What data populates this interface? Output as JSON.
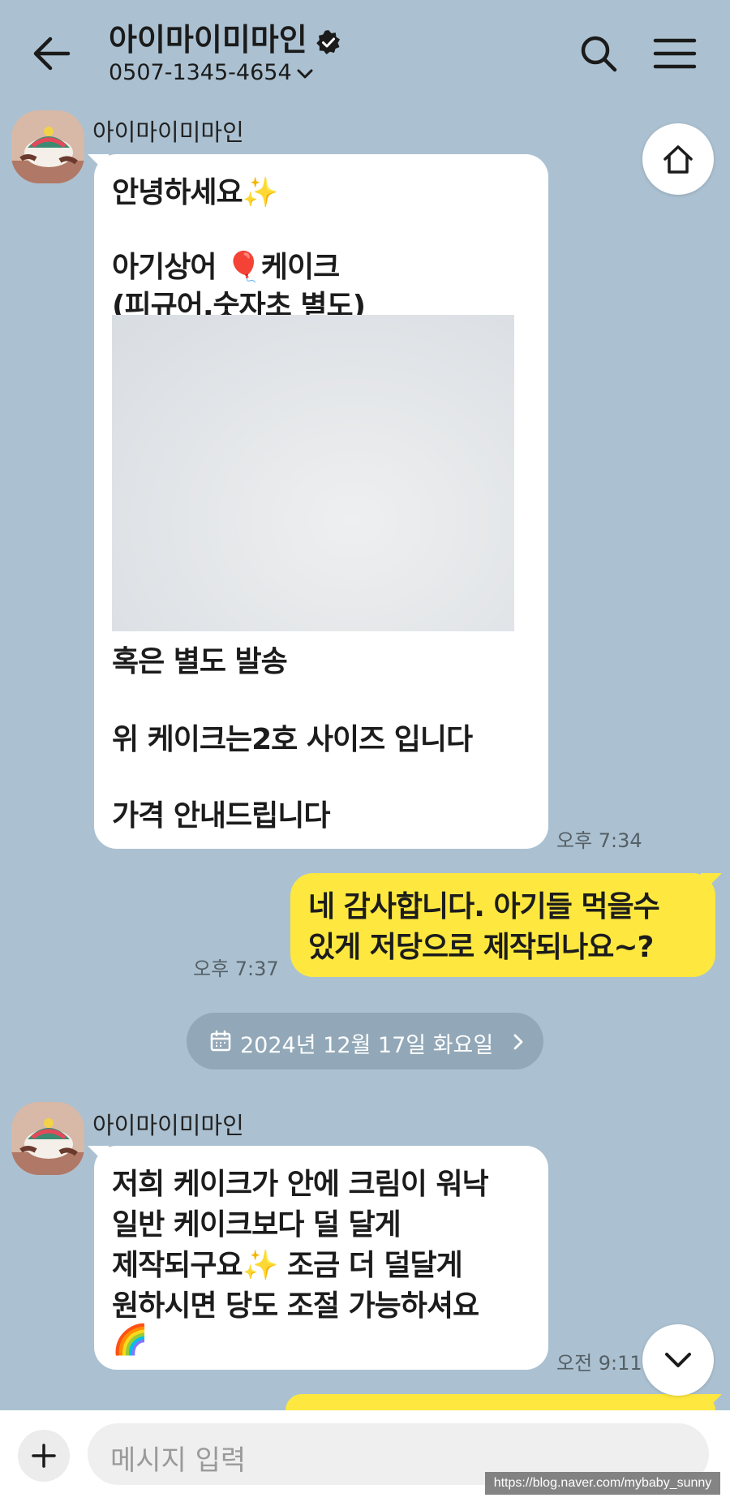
{
  "header": {
    "title": "아이마이미마인",
    "phone": "0507-1345-4654"
  },
  "messages": [
    {
      "sender": "아이마이미마인",
      "lines": [
        "안녕하세요✨",
        "",
        "아기상어 🎈케이크",
        "(피규어,숫자초 별도)"
      ],
      "lines_after_image": [
        "혹은 별도 발송",
        "",
        "위 케이크는2호 사이즈 입니다",
        "",
        "가격 안내드립니다"
      ],
      "time": "오후 7:34"
    },
    {
      "lines": [
        "네 감사합니다. 아기들 먹을수",
        "있게 저당으로 제작되나요~?"
      ],
      "time": "오후 7:37"
    },
    {
      "sender": "아이마이미마인",
      "lines": [
        "저희 케이크가 안에 크림이 워낙",
        "일반 케이크보다 덜 달게",
        "제작되구요✨ 조금 더 덜달게",
        "원하시면 당도 조절 가능하셔요",
        "🌈"
      ],
      "time": "오전 9:11"
    }
  ],
  "date_divider": "2024년 12월 17일 화요일",
  "input": {
    "placeholder": "메시지 입력"
  },
  "watermark": "https://blog.naver.com/mybaby_sunny",
  "colors": {
    "background": "#abc1d1",
    "incoming_bubble": "#ffffff",
    "outgoing_bubble": "#fee83f",
    "date_chip": "#92a8b8"
  },
  "icons": [
    "back-arrow-icon",
    "verified-badge-icon",
    "chevron-down-icon",
    "search-icon",
    "menu-icon",
    "home-icon",
    "calendar-icon",
    "chevron-right-icon",
    "scroll-down-icon",
    "plus-icon"
  ]
}
